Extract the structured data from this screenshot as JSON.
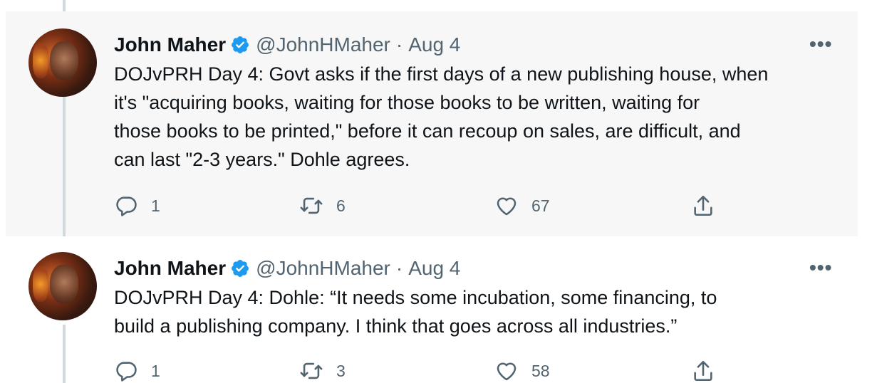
{
  "tweets": [
    {
      "author_name": "John Maher",
      "handle": "@JohnHMaher",
      "separator": "·",
      "date": "Aug 4",
      "more_label": "•••",
      "text_lines": [
        "DOJvPRH Day 4: Govt asks if the first days of a new publishing house, when",
        "it's \"acquiring books, waiting for those books to be written, waiting for",
        "those books to be printed,\" before it can recoup on sales, are difficult, and",
        "can last \"2-3 years.\" Dohle agrees."
      ],
      "reply_count": "1",
      "retweet_count": "6",
      "like_count": "67",
      "highlighted": true
    },
    {
      "author_name": "John Maher",
      "handle": "@JohnHMaher",
      "separator": "·",
      "date": "Aug 4",
      "more_label": "•••",
      "text_lines": [
        "DOJvPRH Day 4: Dohle: “It needs some incubation, some financing, to",
        "build a publishing company. I think that goes across all industries.”"
      ],
      "reply_count": "1",
      "retweet_count": "3",
      "like_count": "58",
      "highlighted": false
    }
  ],
  "icons": {
    "verified": "verified-badge-icon",
    "reply": "reply-icon",
    "retweet": "retweet-icon",
    "like": "heart-icon",
    "share": "share-icon",
    "more": "more-icon"
  },
  "colors": {
    "verified_blue": "#1d9bf0",
    "secondary_text": "#536471",
    "thread_line": "#cfd9de",
    "highlight_bg": "#f7f7f7"
  }
}
